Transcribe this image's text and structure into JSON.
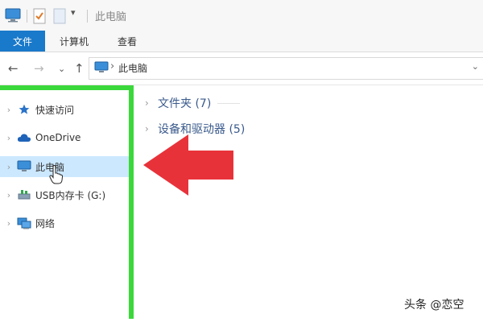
{
  "window": {
    "title": "此电脑"
  },
  "ribbon": {
    "tabs": [
      {
        "label": "文件"
      },
      {
        "label": "计算机"
      },
      {
        "label": "查看"
      }
    ]
  },
  "address": {
    "back_icon": "arrow-left-icon",
    "forward_icon": "arrow-right-icon",
    "recent_icon": "chevron-down-icon",
    "up_icon": "arrow-up-icon",
    "location": "此电脑"
  },
  "sidebar": {
    "items": [
      {
        "label": "快速访问",
        "icon": "star-icon",
        "selected": false
      },
      {
        "label": "OneDrive",
        "icon": "cloud-icon",
        "selected": false
      },
      {
        "label": "此电脑",
        "icon": "computer-icon",
        "selected": true
      },
      {
        "label": "USB内存卡 (G:)",
        "icon": "usb-drive-icon",
        "selected": false
      },
      {
        "label": "网络",
        "icon": "network-icon",
        "selected": false
      }
    ]
  },
  "main": {
    "groups": [
      {
        "label": "文件夹 (7)"
      },
      {
        "label": "设备和驱动器 (5)"
      }
    ]
  },
  "overlay": {
    "watermark": "头条 @恋空",
    "highlight_color": "#3bd83b",
    "arrow_color": "#e8323a"
  }
}
